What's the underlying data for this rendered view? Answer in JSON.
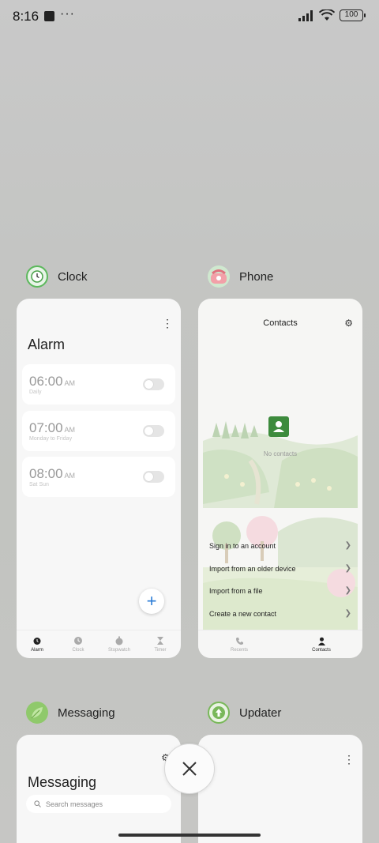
{
  "status_bar": {
    "time": "8:16",
    "dots": "···",
    "battery": "100"
  },
  "apps": [
    {
      "name": "Clock"
    },
    {
      "name": "Phone"
    },
    {
      "name": "Messaging"
    },
    {
      "name": "Updater"
    }
  ],
  "clock": {
    "title": "Alarm",
    "alarms": [
      {
        "time": "06:00",
        "ampm": "AM",
        "sub": "Daily"
      },
      {
        "time": "07:00",
        "ampm": "AM",
        "sub": "Monday to Friday"
      },
      {
        "time": "08:00",
        "ampm": "AM",
        "sub": "Sat Sun"
      }
    ],
    "tabs": [
      "Alarm",
      "Clock",
      "Stopwatch",
      "Timer"
    ]
  },
  "phone": {
    "title": "Contacts",
    "empty": "No contacts",
    "menu": [
      "Sign in to an account",
      "Import from an older device",
      "Import from a file",
      "Create a new contact"
    ],
    "tabs": [
      "Recents",
      "Contacts"
    ]
  },
  "messaging": {
    "title": "Messaging",
    "search_placeholder": "Search messages"
  },
  "colors": {
    "accent_blue": "#2a7bd6",
    "contact_green": "#3d8b3d"
  }
}
